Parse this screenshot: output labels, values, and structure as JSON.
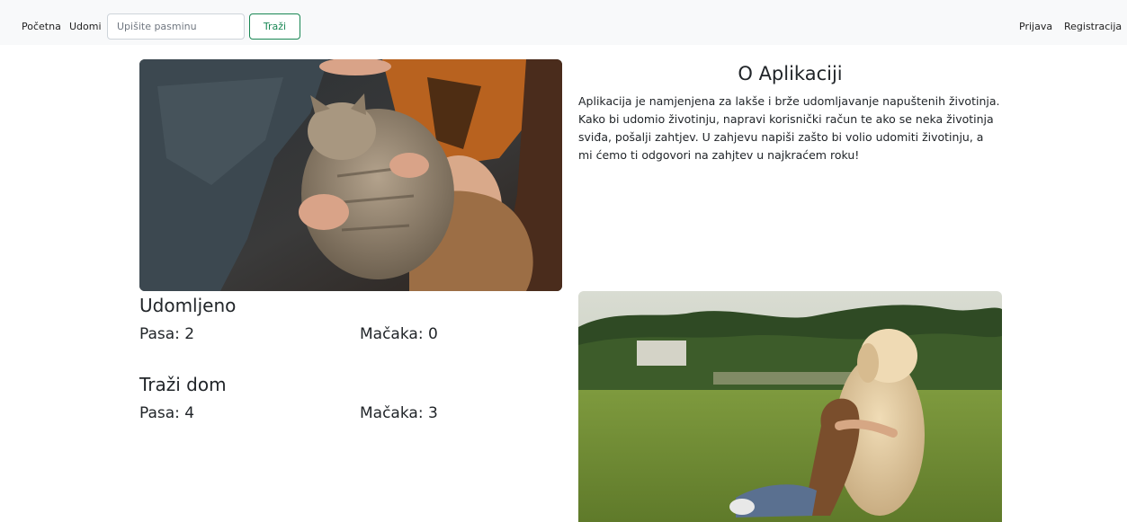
{
  "nav": {
    "home_label": "Početna",
    "adopt_label": "Udomi",
    "search_placeholder": "Upišite pasminu",
    "search_button_label": "Traži",
    "login_label": "Prijava",
    "register_label": "Registracija"
  },
  "about": {
    "title": "O Aplikaciji",
    "text": "Aplikacija je namjenjena za lakše i brže udomljavanje napuštenih životinja. Kako bi udomio životinju, napravi korisnički račun te ako se neka životinja sviđa, pošalji zahtjev. U zahjevu napiši zašto bi volio udomiti životinju, a mi ćemo ti odgovori na zahjtev u najkraćem roku!"
  },
  "stats": {
    "adopted": {
      "title": "Udomljeno",
      "dogs": "Pasa: 2",
      "cats": "Mačaka: 0"
    },
    "seeking": {
      "title": "Traži dom",
      "dogs": "Pasa: 4",
      "cats": "Mačaka: 3"
    }
  },
  "colors": {
    "navbar_bg": "#f8f9fa",
    "accent_green": "#198754",
    "text": "#212529"
  }
}
